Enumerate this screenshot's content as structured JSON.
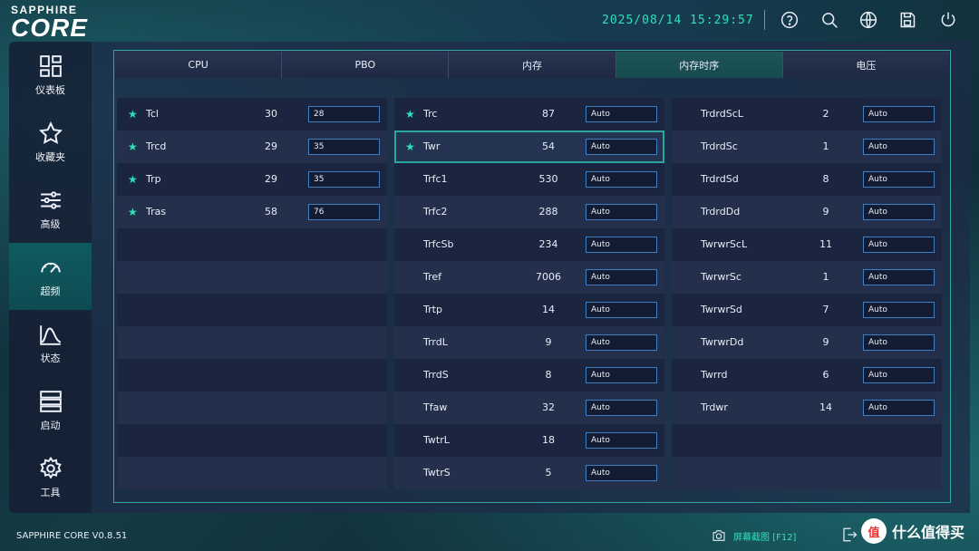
{
  "brand": {
    "line1": "SAPPHIRE",
    "line2": "CORE"
  },
  "header": {
    "datetime": "2025/08/14 15:29:57"
  },
  "sidebar": {
    "items": [
      {
        "label": "仪表板",
        "icon": "dashboard-icon"
      },
      {
        "label": "收藏夹",
        "icon": "star-icon"
      },
      {
        "label": "高级",
        "icon": "sliders-icon"
      },
      {
        "label": "超频",
        "icon": "gauge-icon",
        "active": true
      },
      {
        "label": "状态",
        "icon": "chart-icon"
      },
      {
        "label": "启动",
        "icon": "server-icon"
      },
      {
        "label": "工具",
        "icon": "gear-icon"
      }
    ]
  },
  "tabs": [
    "CPU",
    "PBO",
    "内存",
    "内存时序",
    "电压"
  ],
  "active_tab": "内存时序",
  "columns": [
    {
      "rows": [
        {
          "name": "Tcl",
          "value": "30",
          "input": "28",
          "star": true
        },
        {
          "name": "Trcd",
          "value": "29",
          "input": "35",
          "star": true
        },
        {
          "name": "Trp",
          "value": "29",
          "input": "35",
          "star": true
        },
        {
          "name": "Tras",
          "value": "58",
          "input": "76",
          "star": true
        },
        {},
        {},
        {},
        {},
        {},
        {},
        {},
        {}
      ]
    },
    {
      "rows": [
        {
          "name": "Trc",
          "value": "87",
          "input": "Auto",
          "star": true
        },
        {
          "name": "Twr",
          "value": "54",
          "input": "Auto",
          "star": true,
          "highlight": true
        },
        {
          "name": "Trfc1",
          "value": "530",
          "input": "Auto"
        },
        {
          "name": "Trfc2",
          "value": "288",
          "input": "Auto"
        },
        {
          "name": "TrfcSb",
          "value": "234",
          "input": "Auto"
        },
        {
          "name": "Tref",
          "value": "7006",
          "input": "Auto"
        },
        {
          "name": "Trtp",
          "value": "14",
          "input": "Auto"
        },
        {
          "name": "TrrdL",
          "value": "9",
          "input": "Auto"
        },
        {
          "name": "TrrdS",
          "value": "8",
          "input": "Auto"
        },
        {
          "name": "Tfaw",
          "value": "32",
          "input": "Auto"
        },
        {
          "name": "TwtrL",
          "value": "18",
          "input": "Auto"
        },
        {
          "name": "TwtrS",
          "value": "5",
          "input": "Auto"
        }
      ]
    },
    {
      "rows": [
        {
          "name": "TrdrdScL",
          "value": "2",
          "input": "Auto"
        },
        {
          "name": "TrdrdSc",
          "value": "1",
          "input": "Auto"
        },
        {
          "name": "TrdrdSd",
          "value": "8",
          "input": "Auto"
        },
        {
          "name": "TrdrdDd",
          "value": "9",
          "input": "Auto"
        },
        {
          "name": "TwrwrScL",
          "value": "11",
          "input": "Auto"
        },
        {
          "name": "TwrwrSc",
          "value": "1",
          "input": "Auto"
        },
        {
          "name": "TwrwrSd",
          "value": "7",
          "input": "Auto"
        },
        {
          "name": "TwrwrDd",
          "value": "9",
          "input": "Auto"
        },
        {
          "name": "Twrrd",
          "value": "6",
          "input": "Auto"
        },
        {
          "name": "Trdwr",
          "value": "14",
          "input": "Auto"
        },
        {},
        {}
      ]
    }
  ],
  "footer": {
    "version": "SAPPHIRE CORE V0.8.51",
    "screenshot_label": "屏幕截图 [F12]",
    "watermark_logo": "值",
    "watermark_text": "什么值得买"
  },
  "colors": {
    "accent": "#2fe0b8",
    "input_border": "#3f7ec3",
    "frame": "#2fa7a8"
  }
}
